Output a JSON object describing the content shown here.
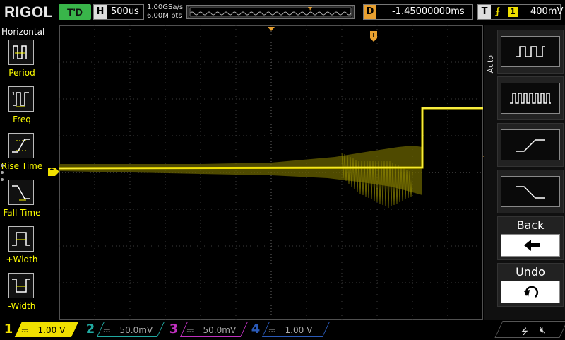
{
  "header": {
    "brand": "RIGOL",
    "run_state": "T'D",
    "horizontal_key": "H",
    "timebase": "500us",
    "sample_rate": "1.00GSa/s",
    "memory_depth": "6.00M pts",
    "delay_key": "D",
    "delay": "-1.45000000ms",
    "trigger_key": "T",
    "trigger_source": "1",
    "trigger_level": "400mV"
  },
  "left_menu": {
    "title": "Horizontal",
    "items": [
      {
        "label": "Period",
        "icon": "period-icon"
      },
      {
        "label": "Freq",
        "icon": "freq-icon"
      },
      {
        "label": "Rise Time",
        "icon": "rise-time-icon"
      },
      {
        "label": "Fall Time",
        "icon": "fall-time-icon"
      },
      {
        "label": "+Width",
        "icon": "positive-width-icon"
      },
      {
        "label": "-Width",
        "icon": "negative-width-icon"
      }
    ]
  },
  "right_menu": {
    "tab": "Auto",
    "buttons": [
      {
        "name": "square-wave",
        "icon": "square-wave-icon"
      },
      {
        "name": "pulse-train",
        "icon": "pulse-train-icon"
      },
      {
        "name": "rising-edge",
        "icon": "rising-edge-icon"
      },
      {
        "name": "falling-edge",
        "icon": "falling-edge-icon"
      },
      {
        "label": "Back",
        "icon": "back-arrow-icon"
      },
      {
        "label": "Undo",
        "icon": "undo-icon"
      }
    ]
  },
  "channels": [
    {
      "num": "1",
      "scale": "1.00 V",
      "color": "#f0e000",
      "active": true
    },
    {
      "num": "2",
      "scale": "50.0mV",
      "color": "#20a8a0",
      "active": false
    },
    {
      "num": "3",
      "scale": "50.0mV",
      "color": "#c030c0",
      "active": false
    },
    {
      "num": "4",
      "scale": "1.00 V",
      "color": "#2a5ab8",
      "active": false
    }
  ],
  "markers": {
    "ch1_ground": "1",
    "trigger_level": "T",
    "trigger_position": "T"
  },
  "colors": {
    "trace": "#f0e000",
    "grid": "#505050",
    "accent": "#e8a030"
  }
}
